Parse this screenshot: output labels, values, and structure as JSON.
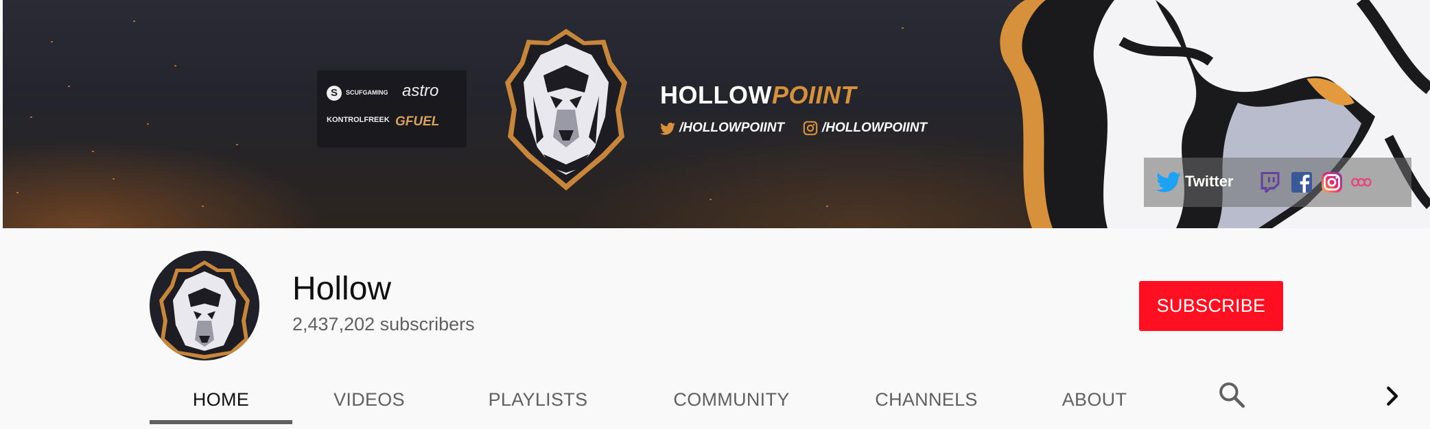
{
  "banner": {
    "sponsors": [
      "SCUFGAMING",
      "astro",
      "KONTROLFREEK",
      "GFUEL"
    ],
    "brand_white": "HOLLOW",
    "brand_gold": "POIINT",
    "twitter_handle": "/HOLLOWPOIINT",
    "instagram_handle": "/HOLLOWPOIINT",
    "links": {
      "twitter_label": "Twitter",
      "icons": [
        "twitter-icon",
        "twitch-icon",
        "facebook-icon",
        "instagram-icon",
        "teespring-icon"
      ]
    },
    "colors": {
      "gold": "#d7903c",
      "dark": "#24252c"
    }
  },
  "channel": {
    "name": "Hollow",
    "subscribers": "2,437,202 subscribers",
    "subscribe_label": "SUBSCRIBE",
    "subscribe_color": "#ff0f1f"
  },
  "tabs": [
    {
      "label": "HOME",
      "active": true
    },
    {
      "label": "VIDEOS",
      "active": false
    },
    {
      "label": "PLAYLISTS",
      "active": false
    },
    {
      "label": "COMMUNITY",
      "active": false
    },
    {
      "label": "CHANNELS",
      "active": false
    },
    {
      "label": "ABOUT",
      "active": false
    }
  ],
  "tab_icons": [
    "search-icon",
    "chevron-right-icon"
  ]
}
